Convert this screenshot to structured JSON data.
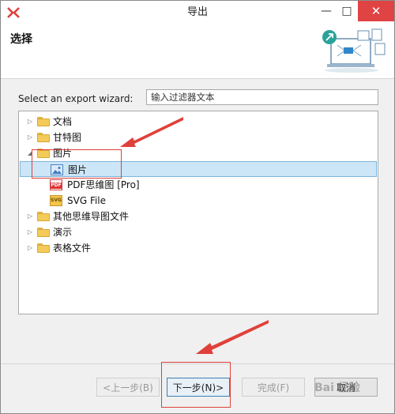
{
  "window": {
    "title": "导出",
    "controls": {
      "minimize": "—",
      "maximize": "□",
      "close": "✕"
    }
  },
  "header": {
    "title": "选择"
  },
  "filter": {
    "label": "Select an export wizard:",
    "value": "输入过滤器文本"
  },
  "tree": {
    "items": [
      {
        "label": "文档",
        "expanded": false,
        "icon": "folder-icon"
      },
      {
        "label": "甘特图",
        "expanded": false,
        "icon": "folder-icon"
      },
      {
        "label": "图片",
        "expanded": true,
        "icon": "folder-icon"
      },
      {
        "label": "图片",
        "selected": true,
        "icon": "image-icon"
      },
      {
        "label": "PDF思维图 [Pro]",
        "icon": "pdf-icon",
        "icon_text": "PDF"
      },
      {
        "label": "SVG File",
        "icon": "svg-icon",
        "icon_text": "SVG"
      },
      {
        "label": "其他思维导图文件",
        "expanded": false,
        "icon": "folder-icon"
      },
      {
        "label": "演示",
        "expanded": false,
        "icon": "folder-icon"
      },
      {
        "label": "表格文件",
        "expanded": false,
        "icon": "folder-icon"
      }
    ]
  },
  "buttons": {
    "back": "<上一步(B)",
    "next": "下一步(N)>",
    "finish": "完成(F)",
    "cancel": "取消"
  },
  "watermark": "Bai 经验",
  "colors": {
    "close_button": "#e04343",
    "selection": "#cce6f7",
    "annotation": "#e0403a",
    "folder": "#f4ca59"
  }
}
